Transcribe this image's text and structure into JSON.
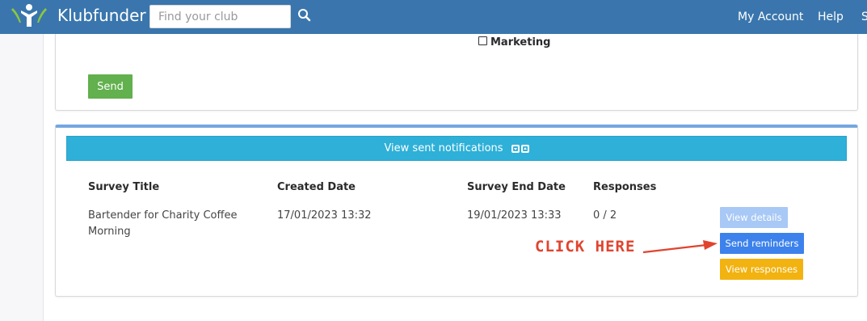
{
  "header": {
    "brand": "Klubfunder",
    "search_placeholder": "Find your club",
    "nav": [
      "My Account",
      "Help",
      "S"
    ]
  },
  "form": {
    "checkbox_label": "Marketing",
    "checkbox_checked": false,
    "send_label": "Send"
  },
  "notifications": {
    "bar_label": "View sent notifications",
    "columns": [
      "Survey Title",
      "Created Date",
      "Survey End Date",
      "Responses"
    ],
    "rows": [
      {
        "title": "Bartender for Charity Coffee Morning",
        "created": "17/01/2023 13:32",
        "end": "19/01/2023 13:33",
        "responses": "0 / 2"
      }
    ],
    "actions": {
      "view_details": "View details",
      "send_reminders": "Send reminders",
      "view_responses": "View responses"
    }
  },
  "annotation": {
    "text": "CLICK HERE",
    "color": "#e0442f"
  },
  "colors": {
    "navbar": "#3a76ad",
    "send_button": "#62b04e",
    "notif_bar": "#2eb0d8",
    "view_details": "#a8c8f6",
    "send_reminders": "#3d82ec",
    "view_responses": "#f2b20f"
  }
}
